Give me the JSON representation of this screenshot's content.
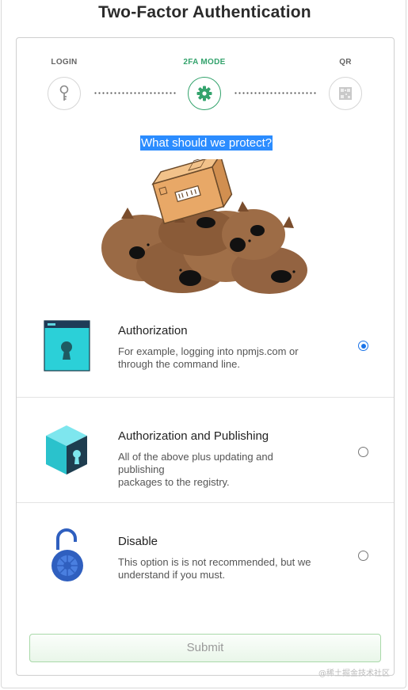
{
  "title": "Two-Factor Authentication",
  "steps": [
    {
      "label": "LOGIN",
      "icon": "key-icon",
      "state": "done"
    },
    {
      "label": "2FA MODE",
      "icon": "gear-icon",
      "state": "active"
    },
    {
      "label": "QR",
      "icon": "qr-icon",
      "state": "pending"
    }
  ],
  "question": "What should we protect?",
  "options": [
    {
      "title": "Authorization",
      "desc_line1": "For example, logging into npmjs.com or",
      "desc_line2": "through the command line.",
      "icon": "browser-lock-icon",
      "checked": true
    },
    {
      "title": "Authorization and Publishing",
      "desc_line1": "All of the above plus updating and publishing",
      "desc_line2": "packages to the registry.",
      "icon": "cube-lock-icon",
      "checked": false
    },
    {
      "title": "Disable",
      "desc_line1": "This option is is not recommended, but we",
      "desc_line2": "understand if you must.",
      "icon": "open-padlock-icon",
      "checked": false
    }
  ],
  "submit_label": "Submit",
  "watermark": "@稀土掘金技术社区",
  "colors": {
    "active_step": "#34a36d",
    "selection": "#2b8cff",
    "radio_checked": "#1a73e8",
    "submit_border": "#a9d9a9"
  }
}
